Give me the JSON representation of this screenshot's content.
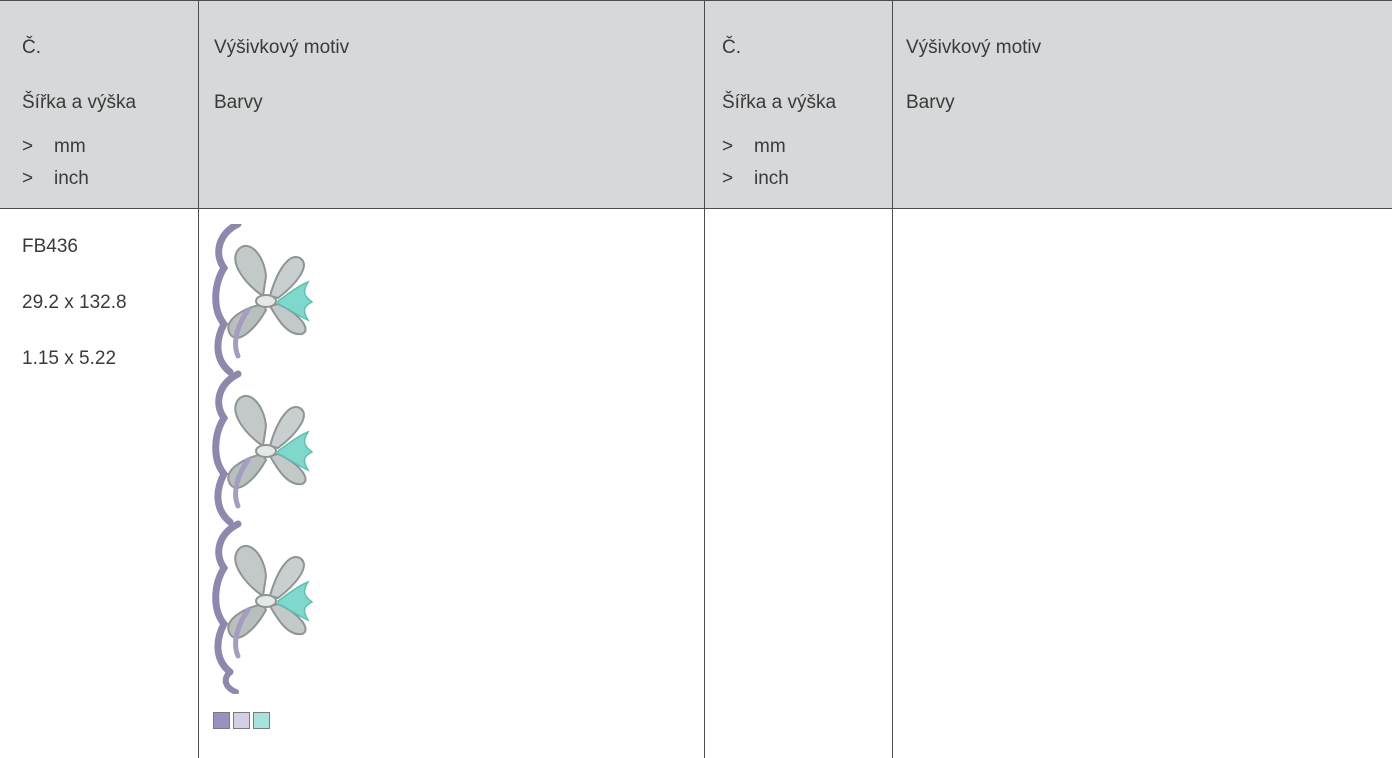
{
  "header": {
    "col1": {
      "number_label": "Č.",
      "size_label": "Šířka a výška",
      "unit_arrow": ">",
      "unit_mm": "mm",
      "unit_inch": "inch"
    },
    "col2": {
      "motif_label": "Výšivkový motiv",
      "colors_label": "Barvy"
    },
    "col3": {
      "number_label": "Č.",
      "size_label": "Šířka a výška",
      "unit_arrow": ">",
      "unit_mm": "mm",
      "unit_inch": "inch"
    },
    "col4": {
      "motif_label": "Výšivkový motiv",
      "colors_label": "Barvy"
    }
  },
  "rows": [
    {
      "code": "FB436",
      "size_mm": "29.2 x 132.8",
      "size_inch": "1.15 x 5.22",
      "motif_icon": "embroidery-bow-border-icon",
      "swatch_colors": [
        "#9b91bf",
        "#d5cfe6",
        "#a6e2e0"
      ]
    }
  ],
  "colors": {
    "header_bg": "#d7d8d9",
    "rule": "#4d4d4d",
    "text": "#3a3a3a",
    "motif_purple": "#8e88ad",
    "motif_silver": "#c3c9c8",
    "motif_mint": "#7fd8cb"
  }
}
